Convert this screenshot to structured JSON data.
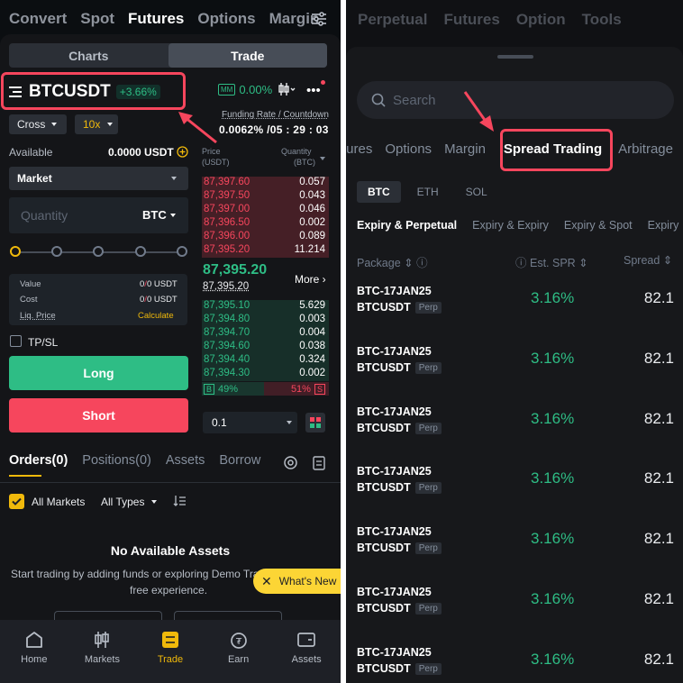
{
  "left": {
    "top_nav": [
      "Convert",
      "Spot",
      "Futures",
      "Options",
      "Margin"
    ],
    "active_nav": "Futures",
    "segment": {
      "charts": "Charts",
      "trade": "Trade"
    },
    "pair": {
      "symbol": "BTCUSDT",
      "change": "+3.66%"
    },
    "mm": {
      "badge": "MM",
      "value": "0.00%"
    },
    "funding": {
      "label": "Funding Rate / Countdown",
      "value": "0.0062% /05 : 29 : 03"
    },
    "margin_mode": "Cross",
    "leverage": "10x",
    "available": {
      "label": "Available",
      "value": "0.0000 USDT"
    },
    "order_type": "Market",
    "quantity": {
      "placeholder": "Quantity",
      "unit": "BTC"
    },
    "info": {
      "value_label": "Value",
      "value": [
        "0",
        "/",
        "0",
        " USDT"
      ],
      "cost_label": "Cost",
      "cost": [
        "0",
        "/",
        "0",
        " USDT"
      ],
      "liq_label": "Liq. Price",
      "liq_action": "Calculate"
    },
    "tpsl": "TP/SL",
    "long": "Long",
    "short": "Short",
    "orderbook": {
      "price_h": "Price",
      "price_unit": "(USDT)",
      "qty_h": "Quantity",
      "qty_unit": "(BTC)",
      "asks": [
        {
          "p": "87,397.60",
          "q": "0.057"
        },
        {
          "p": "87,397.50",
          "q": "0.043"
        },
        {
          "p": "87,397.00",
          "q": "0.046"
        },
        {
          "p": "87,396.50",
          "q": "0.002"
        },
        {
          "p": "87,396.00",
          "q": "0.089"
        },
        {
          "p": "87,395.20",
          "q": "11.214"
        }
      ],
      "mid_price": "87,395.20",
      "mark_price": "87,395.20",
      "more": "More",
      "bids": [
        {
          "p": "87,395.10",
          "q": "5.629"
        },
        {
          "p": "87,394.80",
          "q": "0.003"
        },
        {
          "p": "87,394.70",
          "q": "0.004"
        },
        {
          "p": "87,394.60",
          "q": "0.038"
        },
        {
          "p": "87,394.40",
          "q": "0.324"
        },
        {
          "p": "87,394.30",
          "q": "0.002"
        }
      ],
      "buy_badge": "B",
      "buy_pct": "49%",
      "sell_badge": "S",
      "sell_pct": "51%",
      "step": "0.1"
    },
    "tabs": [
      "Orders(0)",
      "Positions(0)",
      "Assets",
      "Borrow"
    ],
    "filters": {
      "all_markets": "All Markets",
      "all_types": "All Types"
    },
    "empty": {
      "title": "No Available Assets",
      "desc1": "Start trading by adding funds or exploring Demo Tra",
      "desc2": "free experience."
    },
    "toast": "What's New",
    "bottom_nav": [
      "Home",
      "Markets",
      "Trade",
      "Earn",
      "Assets"
    ],
    "colors": {
      "green": "#2ebd85",
      "red": "#f6465d",
      "yellow": "#f0b90b"
    }
  },
  "right": {
    "top_nav": [
      "Perpetual",
      "Futures",
      "Option",
      "Tools"
    ],
    "search_placeholder": "Search",
    "categories": [
      "tures",
      "Options",
      "Margin",
      "Spread Trading",
      "Arbitrage"
    ],
    "coins": [
      "BTC",
      "ETH",
      "SOL"
    ],
    "sub_tabs": [
      "Expiry & Perpetual",
      "Expiry & Expiry",
      "Expiry & Spot",
      "Expiry"
    ],
    "columns": {
      "package": "Package",
      "est": "Est. SPR",
      "spread": "Spread"
    },
    "rows": [
      {
        "leg1": "BTC-17JAN25",
        "leg2": "BTCUSDT",
        "tag": "Perp",
        "spr": "3.16%",
        "spread": "82.1"
      },
      {
        "leg1": "BTC-17JAN25",
        "leg2": "BTCUSDT",
        "tag": "Perp",
        "spr": "3.16%",
        "spread": "82.1"
      },
      {
        "leg1": "BTC-17JAN25",
        "leg2": "BTCUSDT",
        "tag": "Perp",
        "spr": "3.16%",
        "spread": "82.1"
      },
      {
        "leg1": "BTC-17JAN25",
        "leg2": "BTCUSDT",
        "tag": "Perp",
        "spr": "3.16%",
        "spread": "82.1"
      },
      {
        "leg1": "BTC-17JAN25",
        "leg2": "BTCUSDT",
        "tag": "Perp",
        "spr": "3.16%",
        "spread": "82.1"
      },
      {
        "leg1": "BTC-17JAN25",
        "leg2": "BTCUSDT",
        "tag": "Perp",
        "spr": "3.16%",
        "spread": "82.1"
      },
      {
        "leg1": "BTC-17JAN25",
        "leg2": "BTCUSDT",
        "tag": "Perp",
        "spr": "3.16%",
        "spread": "82.1"
      }
    ]
  }
}
